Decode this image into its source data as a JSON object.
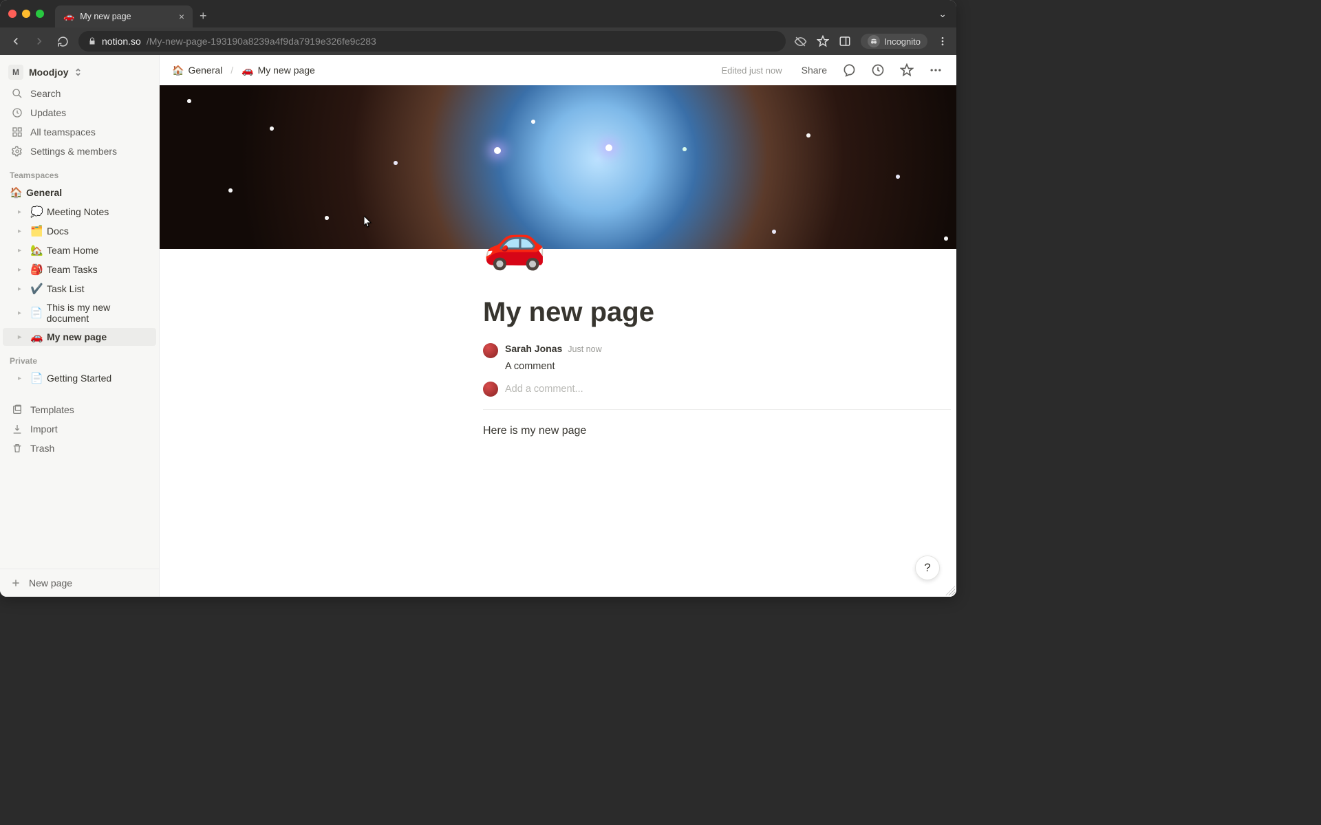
{
  "browser": {
    "tab_icon": "🚗",
    "tab_title": "My new page",
    "url_domain": "notion.so",
    "url_path": "/My-new-page-193190a8239a4f9da7919e326fe9c283",
    "incognito_label": "Incognito"
  },
  "workspace": {
    "avatar_letter": "M",
    "name": "Moodjoy"
  },
  "sidebar_top": [
    {
      "icon": "search",
      "label": "Search"
    },
    {
      "icon": "inbox",
      "label": "Updates"
    },
    {
      "icon": "grid",
      "label": "All teamspaces"
    },
    {
      "icon": "gear",
      "label": "Settings & members"
    }
  ],
  "sidebar_sections": {
    "teamspaces_label": "Teamspaces",
    "private_label": "Private"
  },
  "teamspace_root": {
    "emoji": "🏠",
    "label": "General"
  },
  "teamspace_pages": [
    {
      "emoji": "💭",
      "label": "Meeting Notes"
    },
    {
      "emoji": "🗂️",
      "label": "Docs"
    },
    {
      "emoji": "🏡",
      "label": "Team Home"
    },
    {
      "emoji": "🎒",
      "label": "Team Tasks"
    },
    {
      "emoji": "✔️",
      "label": "Task List"
    },
    {
      "emoji": "📄",
      "label": "This is my new document"
    },
    {
      "emoji": "🚗",
      "label": "My new page",
      "active": true
    }
  ],
  "private_pages": [
    {
      "emoji": "📄",
      "label": "Getting Started"
    }
  ],
  "sidebar_bottom": [
    {
      "icon": "templates",
      "label": "Templates"
    },
    {
      "icon": "import",
      "label": "Import"
    },
    {
      "icon": "trash",
      "label": "Trash"
    }
  ],
  "new_page_label": "New page",
  "breadcrumb": [
    {
      "emoji": "🏠",
      "label": "General"
    },
    {
      "emoji": "🚗",
      "label": "My new page"
    }
  ],
  "topbar": {
    "edited_status": "Edited just now",
    "share_label": "Share"
  },
  "page": {
    "icon": "🚗",
    "title": "My new page",
    "body": "Here is my new page"
  },
  "comments": [
    {
      "author": "Sarah Jonas",
      "time": "Just now",
      "text": "A comment"
    }
  ],
  "add_comment_placeholder": "Add a comment...",
  "help_label": "?"
}
